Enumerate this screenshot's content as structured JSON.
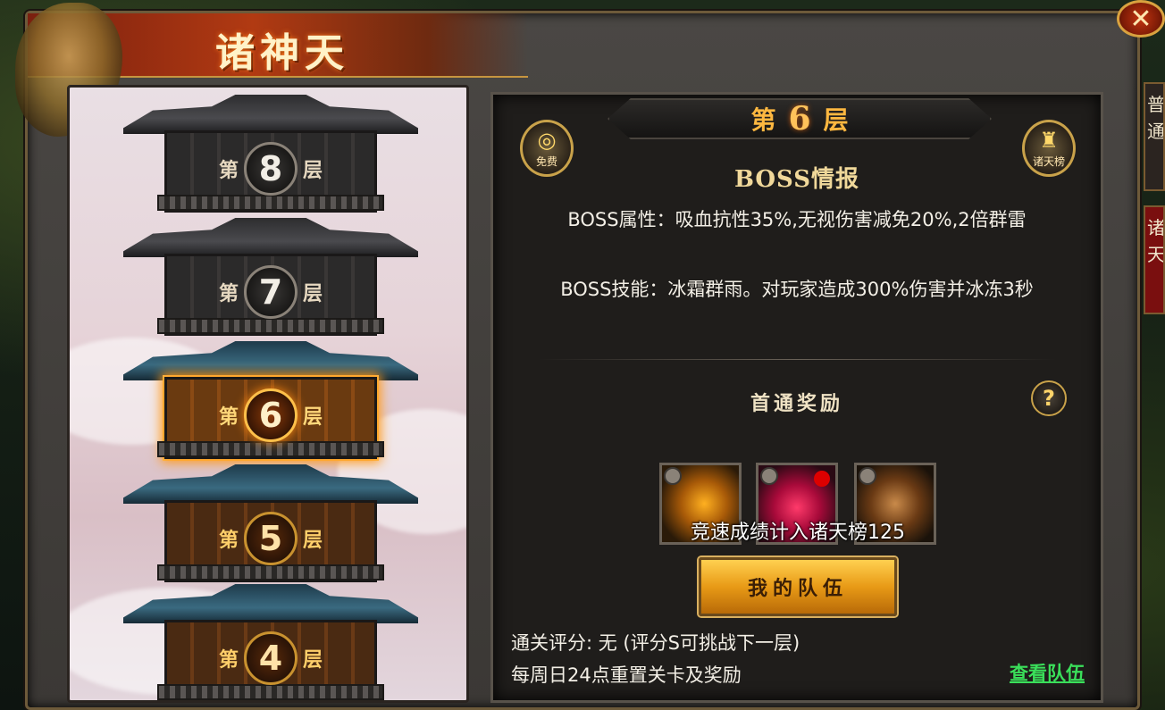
{
  "window": {
    "title": "诸神天",
    "close_label": "✕"
  },
  "side_tabs": [
    {
      "label": "普通"
    },
    {
      "label": "诸天"
    }
  ],
  "tower": {
    "floors": [
      {
        "prefix": "第",
        "number": "8",
        "suffix": "层",
        "state": "locked"
      },
      {
        "prefix": "第",
        "number": "7",
        "suffix": "层",
        "state": "locked"
      },
      {
        "prefix": "第",
        "number": "6",
        "suffix": "层",
        "state": "active"
      },
      {
        "prefix": "第",
        "number": "5",
        "suffix": "层",
        "state": "cleared"
      },
      {
        "prefix": "第",
        "number": "4",
        "suffix": "层",
        "state": "cleared"
      }
    ]
  },
  "info": {
    "layer_prefix": "第",
    "layer_number": "6",
    "layer_suffix": "层",
    "left_icon_label": "免费",
    "right_icon_label": "诸天榜",
    "boss_title": "BOSS情报",
    "boss_attr": "BOSS属性：吸血抗性35%,无视伤害减免20%,2倍群雷",
    "boss_skill": "BOSS技能：冰霜群雨。对玩家造成300%伤害并冰冻3秒",
    "reward_title": "首通奖励",
    "help_label": "?",
    "reward_note": "竞速成绩计入诸天榜125",
    "team_button": "我的队伍",
    "rating": "通关评分: 无 (评分S可挑战下一层)",
    "reset_note": "每周日24点重置关卡及奖励",
    "view_team": "查看队伍"
  },
  "colors": {
    "accent_gold": "#ffb840",
    "link_green": "#3adf5a",
    "title_red": "#b13a12"
  }
}
